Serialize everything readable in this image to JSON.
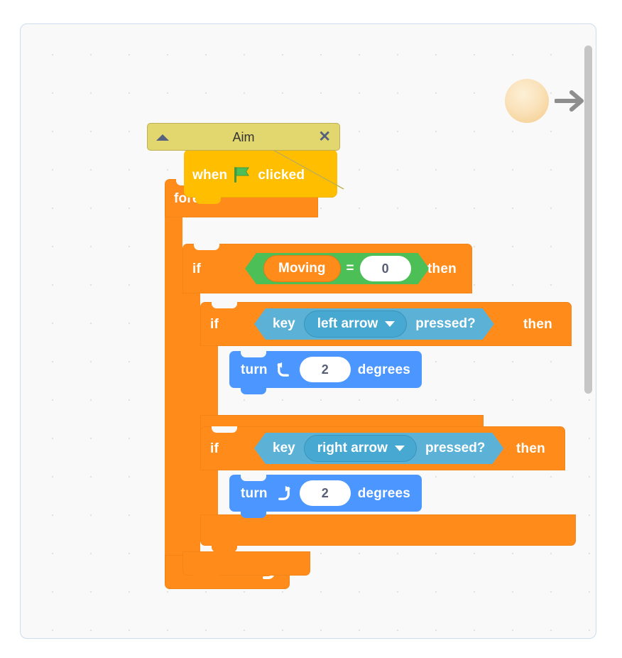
{
  "workspace": {
    "name": "block-editor-canvas",
    "background_color": "#f9f9f9",
    "border_color": "#cddcf0",
    "grid": "dots"
  },
  "sprite_preview": {
    "sprite_name": "ball-sprite",
    "sprite_color": "#fae2bb",
    "direction_arrow": "arrow-right",
    "arrow_color": "#8e8e8e"
  },
  "scrollbar": {
    "name": "vertical-scrollbar",
    "color": "#c6c6c6"
  },
  "comment": {
    "title": "Aim",
    "close_label": "✕",
    "background_color": "#e2d66e",
    "collapse_icon": "triangle-up-icon"
  },
  "script": {
    "hat": {
      "when_label": "when",
      "flag_icon": "green-flag-icon",
      "clicked_label": "clicked",
      "color": "#ffbf00"
    },
    "forever": {
      "label": "forever",
      "color": "#ff8c1a",
      "loop_icon": "loop-arrow-icon"
    },
    "if_moving": {
      "if_label": "if",
      "then_label": "then",
      "condition": {
        "operator": "=",
        "left_variable": "Moving",
        "right_value": "0",
        "operator_color": "#4cbf56",
        "variable_color": "#ff8c1a"
      }
    },
    "if_left": {
      "if_label": "if",
      "then_label": "then",
      "condition": {
        "key_label": "key",
        "key_value": "left arrow",
        "pressed_label": "pressed?",
        "dropdown_icon": "chevron-down-icon",
        "color": "#5cb1d6"
      },
      "body": {
        "turn_label": "turn",
        "turn_icon": "turn-counterclockwise-icon",
        "degrees_value": "2",
        "degrees_label": "degrees",
        "color": "#4c97ff"
      }
    },
    "if_right": {
      "if_label": "if",
      "then_label": "then",
      "condition": {
        "key_label": "key",
        "key_value": "right arrow",
        "pressed_label": "pressed?",
        "dropdown_icon": "chevron-down-icon",
        "color": "#5cb1d6"
      },
      "body": {
        "turn_label": "turn",
        "turn_icon": "turn-clockwise-icon",
        "degrees_value": "2",
        "degrees_label": "degrees",
        "color": "#4c97ff"
      }
    }
  }
}
